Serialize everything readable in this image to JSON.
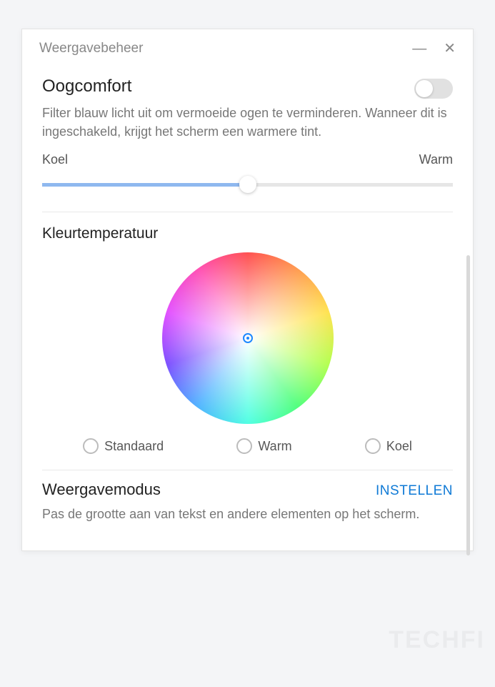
{
  "window": {
    "title": "Weergavebeheer"
  },
  "eyeComfort": {
    "title": "Oogcomfort",
    "desc": "Filter blauw licht uit om vermoeide ogen te verminderen. Wanneer dit is ingeschakeld, krijgt het scherm een warmere tint.",
    "toggle": false,
    "slider": {
      "leftLabel": "Koel",
      "rightLabel": "Warm",
      "valuePercent": 50
    }
  },
  "colorTemperature": {
    "title": "Kleurtemperatuur",
    "options": [
      {
        "label": "Standaard",
        "selected": false
      },
      {
        "label": "Warm",
        "selected": false
      },
      {
        "label": "Koel",
        "selected": false
      }
    ]
  },
  "displayMode": {
    "title": "Weergavemodus",
    "action": "INSTELLEN",
    "desc": "Pas de grootte aan van tekst en andere elementen op het scherm."
  },
  "watermark": "TECHFI"
}
